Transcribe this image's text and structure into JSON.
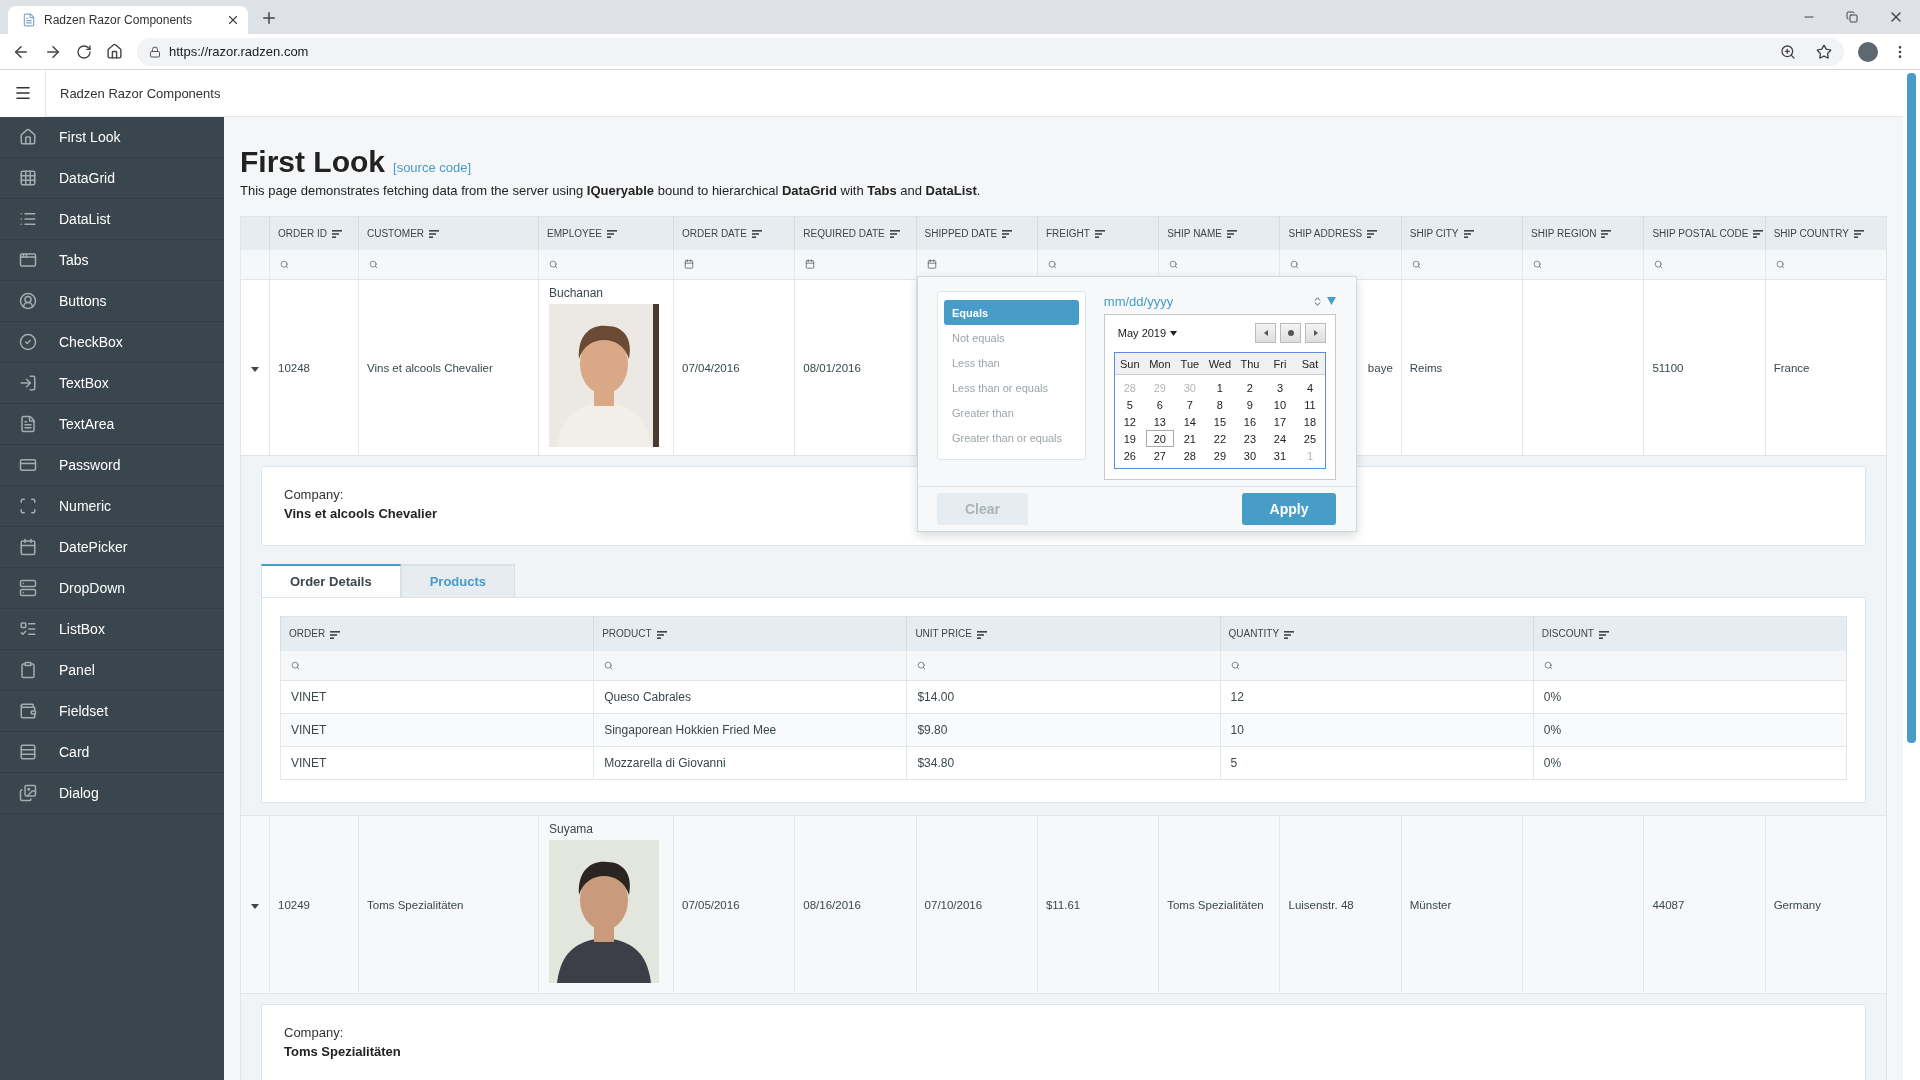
{
  "browser": {
    "tab_title": "Radzen Razor Components",
    "url": "https://razor.radzen.com"
  },
  "app": {
    "title": "Radzen Razor Components"
  },
  "sidebar": {
    "items": [
      {
        "label": "First Look"
      },
      {
        "label": "DataGrid"
      },
      {
        "label": "DataList"
      },
      {
        "label": "Tabs"
      },
      {
        "label": "Buttons"
      },
      {
        "label": "CheckBox"
      },
      {
        "label": "TextBox"
      },
      {
        "label": "TextArea"
      },
      {
        "label": "Password"
      },
      {
        "label": "Numeric"
      },
      {
        "label": "DatePicker"
      },
      {
        "label": "DropDown"
      },
      {
        "label": "ListBox"
      },
      {
        "label": "Panel"
      },
      {
        "label": "Fieldset"
      },
      {
        "label": "Card"
      },
      {
        "label": "Dialog"
      }
    ]
  },
  "page": {
    "title": "First Look",
    "source_link": "[source code]",
    "description": "This page demonstrates fetching data from the server using **IQueryable** bound to hierarchical **DataGrid** with **Tabs** and **DataList**."
  },
  "grid": {
    "columns": [
      {
        "label": "ORDER ID",
        "kind": "text"
      },
      {
        "label": "CUSTOMER",
        "kind": "text"
      },
      {
        "label": "EMPLOYEE",
        "kind": "text"
      },
      {
        "label": "ORDER DATE",
        "kind": "date"
      },
      {
        "label": "REQUIRED DATE",
        "kind": "date"
      },
      {
        "label": "SHIPPED DATE",
        "kind": "date"
      },
      {
        "label": "FREIGHT",
        "kind": "text"
      },
      {
        "label": "SHIP NAME",
        "kind": "text"
      },
      {
        "label": "SHIP ADDRESS",
        "kind": "text"
      },
      {
        "label": "SHIP CITY",
        "kind": "text"
      },
      {
        "label": "SHIP REGION",
        "kind": "text"
      },
      {
        "label": "SHIP POSTAL CODE",
        "kind": "text"
      },
      {
        "label": "SHIP COUNTRY",
        "kind": "text"
      }
    ],
    "rows": [
      {
        "expanded": true,
        "cells": [
          "10248",
          "Vins et alcools Chevalier",
          {
            "name": "Buchanan",
            "kind": "picture"
          },
          "07/04/2016",
          "08/01/2016",
          null,
          null,
          null,
          {
            "text": "baye",
            "kind": "partial"
          },
          "Reims",
          null,
          "51100",
          "France"
        ],
        "detail": {
          "company_label": "Company:",
          "company": "Vins et alcools Chevalier",
          "tabs": [
            {
              "label": "Order Details",
              "selected": true
            },
            {
              "label": "Products",
              "selected": false
            }
          ],
          "columns": [
            "ORDER",
            "PRODUCT",
            "UNIT PRICE",
            "QUANTITY",
            "DISCOUNT"
          ],
          "rows": [
            [
              "VINET",
              "Queso Cabrales",
              "$14.00",
              "12",
              "0%"
            ],
            [
              "VINET",
              "Singaporean Hokkien Fried Mee",
              "$9.80",
              "10",
              "0%"
            ],
            [
              "VINET",
              "Mozzarella di Giovanni",
              "$34.80",
              "5",
              "0%"
            ]
          ]
        }
      },
      {
        "expanded": true,
        "cells": [
          "10249",
          "Toms Spezialitäten",
          {
            "name": "Suyama",
            "kind": "picture"
          },
          "07/05/2016",
          "08/16/2016",
          "07/10/2016",
          "$11.61",
          "Toms Spezialitäten",
          "Luisenstr. 48",
          "Münster",
          null,
          "44087",
          "Germany"
        ],
        "detail": {
          "company_label": "Company:",
          "company": "Toms Spezialitäten"
        }
      }
    ],
    "filter_popup": {
      "operators": [
        {
          "label": "Equals",
          "selected": true
        },
        {
          "label": "Not equals",
          "selected": false
        },
        {
          "label": "Less than",
          "selected": false
        },
        {
          "label": "Less than or equals",
          "selected": false
        },
        {
          "label": "Greater than",
          "selected": false
        },
        {
          "label": "Greater than or equals",
          "selected": false
        }
      ],
      "date_placeholder": "mm/dd/yyyy",
      "calendar": {
        "month": "May 2019",
        "weekdays": [
          "Sun",
          "Mon",
          "Tue",
          "Wed",
          "Thu",
          "Fri",
          "Sat"
        ],
        "days": [
          {
            "label": "28",
            "other_month": true,
            "selected": false
          },
          {
            "label": "29",
            "other_month": true,
            "selected": false
          },
          {
            "label": "30",
            "other_month": true,
            "selected": false
          },
          {
            "label": "1",
            "other_month": false,
            "selected": false
          },
          {
            "label": "2",
            "other_month": false,
            "selected": false
          },
          {
            "label": "3",
            "other_month": false,
            "selected": false
          },
          {
            "label": "4",
            "other_month": false,
            "selected": false
          },
          {
            "label": "5",
            "other_month": false,
            "selected": false
          },
          {
            "label": "6",
            "other_month": false,
            "selected": false
          },
          {
            "label": "7",
            "other_month": false,
            "selected": false
          },
          {
            "label": "8",
            "other_month": false,
            "selected": false
          },
          {
            "label": "9",
            "other_month": false,
            "selected": false
          },
          {
            "label": "10",
            "other_month": false,
            "selected": false
          },
          {
            "label": "11",
            "other_month": false,
            "selected": false
          },
          {
            "label": "12",
            "other_month": false,
            "selected": false
          },
          {
            "label": "13",
            "other_month": false,
            "selected": false
          },
          {
            "label": "14",
            "other_month": false,
            "selected": false
          },
          {
            "label": "15",
            "other_month": false,
            "selected": false
          },
          {
            "label": "16",
            "other_month": false,
            "selected": false
          },
          {
            "label": "17",
            "other_month": false,
            "selected": false
          },
          {
            "label": "18",
            "other_month": false,
            "selected": false
          },
          {
            "label": "19",
            "other_month": false,
            "selected": false
          },
          {
            "label": "20",
            "other_month": false,
            "selected": true
          },
          {
            "label": "21",
            "other_month": false,
            "selected": false
          },
          {
            "label": "22",
            "other_month": false,
            "selected": false
          },
          {
            "label": "23",
            "other_month": false,
            "selected": false
          },
          {
            "label": "24",
            "other_month": false,
            "selected": false
          },
          {
            "label": "25",
            "other_month": false,
            "selected": false
          },
          {
            "label": "26",
            "other_month": false,
            "selected": false
          },
          {
            "label": "27",
            "other_month": false,
            "selected": false
          },
          {
            "label": "28",
            "other_month": false,
            "selected": false
          },
          {
            "label": "29",
            "other_month": false,
            "selected": false
          },
          {
            "label": "30",
            "other_month": false,
            "selected": false
          },
          {
            "label": "31",
            "other_month": false,
            "selected": false
          },
          {
            "label": "1",
            "other_month": true,
            "selected": false
          }
        ]
      },
      "buttons": [
        {
          "label": "Clear",
          "kind": "secondary"
        },
        {
          "label": "Apply",
          "kind": "primary"
        }
      ]
    }
  }
}
